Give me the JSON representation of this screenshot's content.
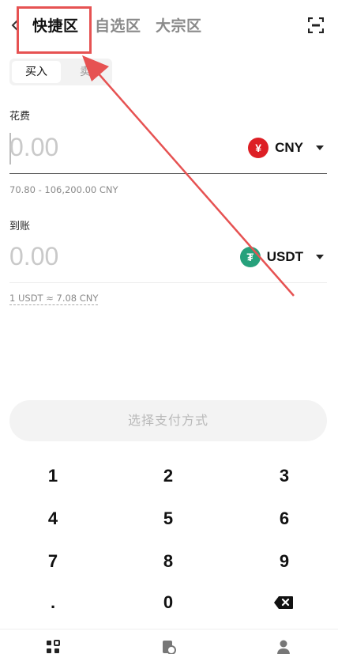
{
  "header": {
    "tabs": [
      {
        "label": "快捷区",
        "active": true
      },
      {
        "label": "自选区",
        "active": false
      },
      {
        "label": "大宗区",
        "active": false
      }
    ]
  },
  "trade_mode": {
    "options": [
      "买入",
      "卖出"
    ],
    "selected": "买入",
    "visible_sell_label": "卖"
  },
  "spend": {
    "label": "花费",
    "amount": "0.00",
    "currency_code": "CNY",
    "currency_symbol": "¥",
    "range_hint": "70.80 - 106,200.00 CNY"
  },
  "receive": {
    "label": "到账",
    "amount": "0.00",
    "currency_code": "USDT",
    "currency_symbol": "₮",
    "rate_hint": "1 USDT ≈ 7.08 CNY"
  },
  "action": {
    "pay_method_label": "选择支付方式"
  },
  "keypad": {
    "keys": [
      "1",
      "2",
      "3",
      "4",
      "5",
      "6",
      "7",
      "8",
      "9",
      ".",
      "0"
    ]
  },
  "colors": {
    "cny_red": "#dd1f25",
    "usdt_green": "#26a17b",
    "annotation_red": "#e65252"
  }
}
